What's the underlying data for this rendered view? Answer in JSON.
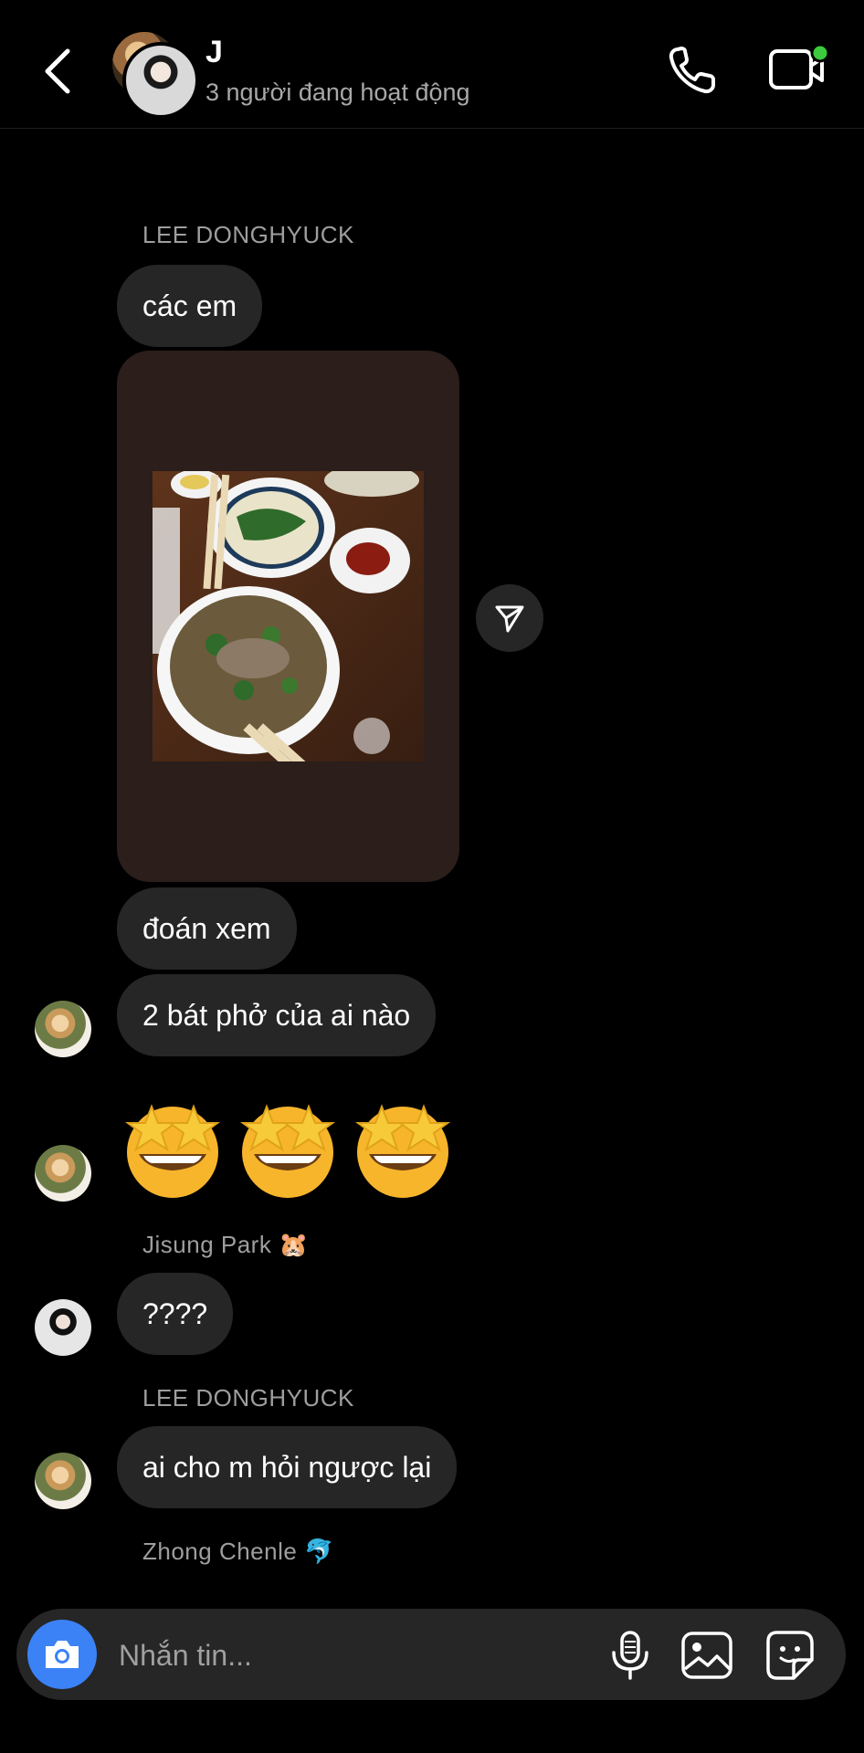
{
  "header": {
    "title": "J",
    "status": "3 người đang hoạt động",
    "icons": {
      "back": "chevron-left-icon",
      "call": "phone-icon",
      "video": "video-camera-icon"
    },
    "active_dot_color": "#3ccb3c"
  },
  "messages": [
    {
      "sender": "LEE DONGHYUCK",
      "text": "các em"
    },
    {
      "type": "shared-post",
      "image": "two-bowls-of-pho"
    },
    {
      "text": "đoán xem"
    },
    {
      "text": "2 bát phở của ai nào"
    },
    {
      "type": "emoji",
      "text": "🤩🤩🤩"
    },
    {
      "sender": "Jisung Park 🐹",
      "text": "????"
    },
    {
      "sender": "LEE DONGHYUCK",
      "text": "ai cho m hỏi ngược lại"
    },
    {
      "sender": "Zhong Chenle 🐬"
    }
  ],
  "composer": {
    "placeholder": "Nhắn tin...",
    "icons": [
      "camera-icon",
      "microphone-icon",
      "gallery-icon",
      "sticker-icon"
    ],
    "camera_color": "#3b82f6"
  }
}
